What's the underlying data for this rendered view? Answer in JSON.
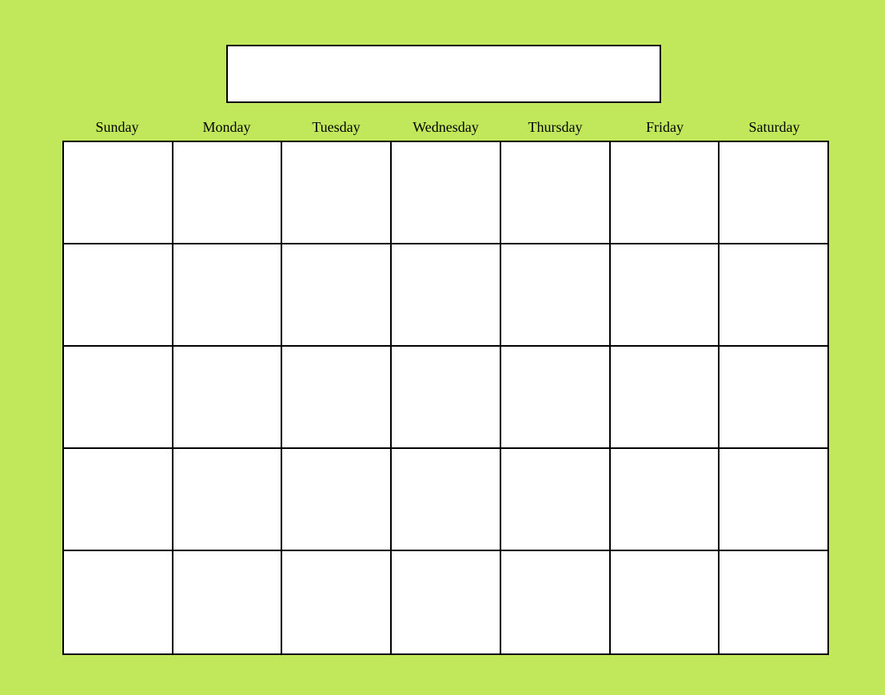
{
  "title": "",
  "days": [
    "Sunday",
    "Monday",
    "Tuesday",
    "Wednesday",
    "Thursday",
    "Friday",
    "Saturday"
  ],
  "rows": 5,
  "cols": 7,
  "colors": {
    "background": "#c0e85a",
    "cell": "#ffffff",
    "border": "#000000"
  }
}
